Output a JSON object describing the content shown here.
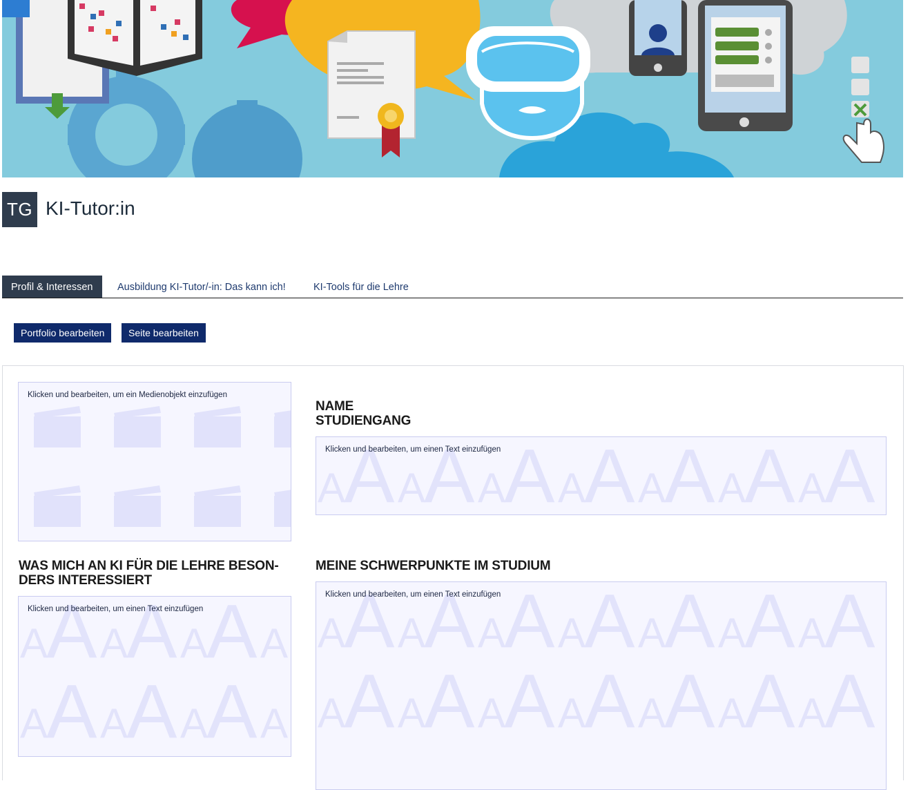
{
  "header": {
    "avatar_initials": "TG",
    "title": "KI-Tutor:in"
  },
  "tabs": [
    {
      "label": "Profil & Interessen",
      "active": true
    },
    {
      "label": "Ausbildung KI-Tutor/-in: Das kann ich!",
      "active": false
    },
    {
      "label": "KI-Tools für die Lehre",
      "active": false
    }
  ],
  "actions": {
    "edit_portfolio": "Portfolio bearbeiten",
    "edit_page": "Seite bearbeiten"
  },
  "blocks": {
    "media": {
      "hint": "Klicken und bearbeiten, um ein Medienobjekt einzufügen"
    },
    "name": {
      "heading_line1": "NAME",
      "heading_line2": "STUDIENGANG",
      "hint": "Klicken und bearbeiten, um einen Text einzufügen"
    },
    "interests": {
      "heading_line1": "WAS MICH AN KI FÜR DIE LEHRE BESON-",
      "heading_line2": "DERS INTERESSIERT",
      "hint": "Klicken und bearbeiten, um einen Text einzufügen"
    },
    "focus": {
      "heading": "MEINE SCHWERPUNKTE IM STUDIUM",
      "hint": "Klicken und bearbeiten, um einen Text einzufügen"
    }
  },
  "colors": {
    "banner_bg": "#84cbdd",
    "tab_active_bg": "#2f3c4d",
    "button_bg": "#0f2a6b",
    "placeholder_bg": "#f6f6ff"
  }
}
